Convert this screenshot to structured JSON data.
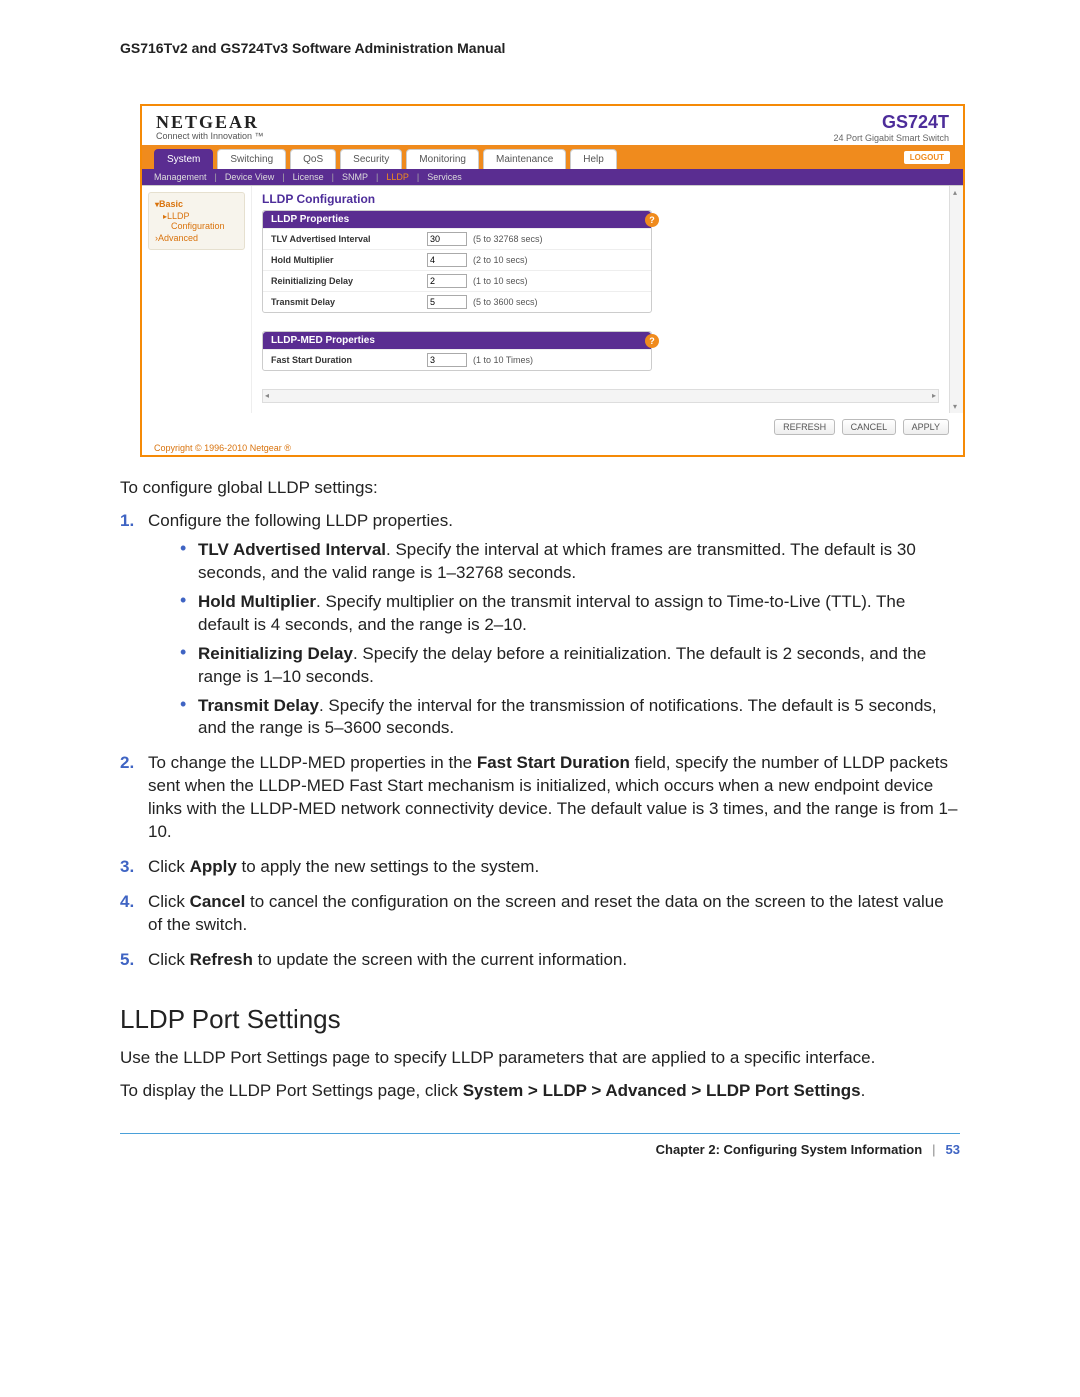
{
  "header": {
    "title": "GS716Tv2 and GS724Tv3 Software Administration Manual"
  },
  "screenshot": {
    "brand": "NETGEAR",
    "slogan": "Connect with Innovation ™",
    "model": "GS724T",
    "model_sub": "24 Port Gigabit Smart Switch",
    "logout": "LOGOUT",
    "tabs": [
      "System",
      "Switching",
      "QoS",
      "Security",
      "Monitoring",
      "Maintenance",
      "Help"
    ],
    "active_tab": "System",
    "subnav": [
      "Management",
      "Device View",
      "License",
      "SNMP",
      "LLDP",
      "Services"
    ],
    "subnav_active": "LLDP",
    "side": {
      "basic": "Basic",
      "lldp": "LLDP",
      "config": "Configuration",
      "advanced": "Advanced"
    },
    "panel": {
      "title": "LLDP Configuration",
      "box1_title": "LLDP Properties",
      "box2_title": "LLDP-MED Properties",
      "rows1": [
        {
          "label": "TLV Advertised Interval",
          "val": "30",
          "hint": "(5 to 32768 secs)"
        },
        {
          "label": "Hold Multiplier",
          "val": "4",
          "hint": "(2 to 10 secs)"
        },
        {
          "label": "Reinitializing Delay",
          "val": "2",
          "hint": "(1 to 10 secs)"
        },
        {
          "label": "Transmit Delay",
          "val": "5",
          "hint": "(5 to 3600 secs)"
        }
      ],
      "rows2": [
        {
          "label": "Fast Start Duration",
          "val": "3",
          "hint": "(1 to 10 Times)"
        }
      ]
    },
    "buttons": {
      "refresh": "REFRESH",
      "cancel": "CANCEL",
      "apply": "APPLY"
    },
    "copyright": "Copyright © 1996-2010 Netgear ®"
  },
  "doc": {
    "intro": "To configure global LLDP settings:",
    "step1_lead": "Configure the following LLDP properties.",
    "b1_strong": "TLV Advertised Interval",
    "b1_text": ". Specify the interval at which frames are transmitted. The default is 30 seconds, and the valid range is 1–32768 seconds.",
    "b2_strong": "Hold Multiplier",
    "b2_text": ". Specify multiplier on the transmit interval to assign to Time-to-Live (TTL). The default is 4 seconds, and the range is 2–10.",
    "b3_strong": "Reinitializing Delay",
    "b3_text": ". Specify the delay before a reinitialization. The default is 2 seconds, and the range is 1–10 seconds.",
    "b4_strong": "Transmit Delay",
    "b4_text": ". Specify the interval for the transmission of notifications. The default is 5 seconds, and the range is 5–3600 seconds.",
    "step2_pre": "To change the LLDP-MED properties in the ",
    "step2_strong": "Fast Start Duration",
    "step2_post": " field, specify the number of LLDP packets sent when the LLDP-MED Fast Start mechanism is initialized, which occurs when a new endpoint device links with the LLDP-MED network connectivity device. The default value is 3 times, and the range is from 1–10.",
    "step3_pre": "Click ",
    "step3_strong": "Apply",
    "step3_post": " to apply the new settings to the system.",
    "step4_pre": "Click ",
    "step4_strong": "Cancel",
    "step4_post": " to cancel the configuration on the screen and reset the data on the screen to the latest value of the switch.",
    "step5_pre": "Click ",
    "step5_strong": "Refresh",
    "step5_post": " to update the screen with the current information.",
    "section_title": "LLDP Port Settings",
    "sec_p1": "Use the LLDP Port Settings page to specify LLDP parameters that are applied to a specific interface.",
    "sec_p2_pre": "To display the LLDP Port Settings page, click ",
    "sec_p2_strong": "System > LLDP > Advanced > LLDP Port Settings",
    "sec_p2_post": "."
  },
  "footer": {
    "chapter": "Chapter 2:  Configuring System Information",
    "sep": "|",
    "page": "53"
  }
}
